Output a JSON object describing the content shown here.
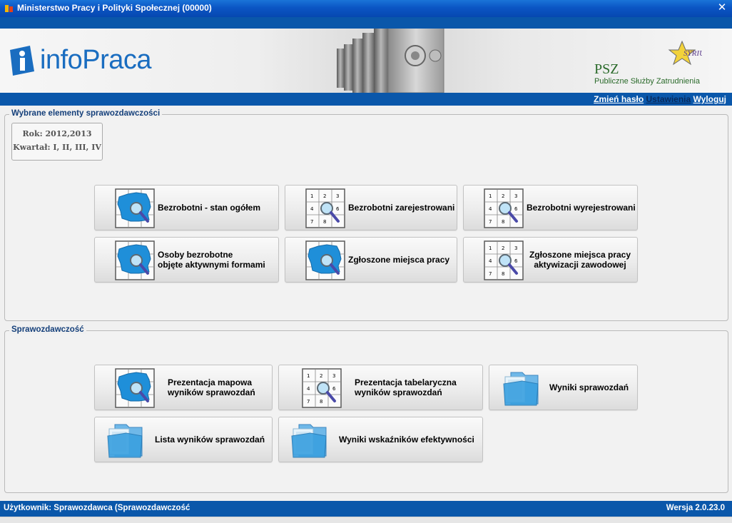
{
  "window": {
    "title": "Ministerstwo Pracy i Polityki Społecznej (00000)"
  },
  "header": {
    "logo_text": "infoPraca",
    "psz_title": "PSZ",
    "psz_subtitle": "Publiczne Służby Zatrudnienia",
    "links": {
      "change_password": "Zmień hasło",
      "settings": "Ustawienia",
      "logout": "Wyloguj"
    }
  },
  "selected": {
    "title": "Wybrane elementy sprawozdawczości",
    "year": "Rok: 2012,2013",
    "quarter": "Kwartał: I, II, III, IV",
    "buttons": [
      {
        "label": "Bezrobotni - stan ogółem",
        "icon": "map-icon"
      },
      {
        "label": "Bezrobotni zarejestrowani",
        "icon": "table-icon"
      },
      {
        "label": "Bezrobotni wyrejestrowani",
        "icon": "table-icon"
      },
      {
        "label1": "Osoby bezrobotne",
        "label2": "objęte aktywnymi formami",
        "icon": "map-icon"
      },
      {
        "label": "Zgłoszone miejsca pracy",
        "icon": "map-icon"
      },
      {
        "label1": "Zgłoszone miejsca pracy",
        "label2": "aktywizacji zawodowej",
        "icon": "table-icon"
      }
    ]
  },
  "reporting": {
    "title": "Sprawozdawczość",
    "buttons": [
      {
        "label1": "Prezentacja mapowa",
        "label2": "wyników sprawozdań",
        "icon": "map-icon"
      },
      {
        "label1": "Prezentacja tabelaryczna",
        "label2": "wyników sprawozdań",
        "icon": "table-icon"
      },
      {
        "label": "Wyniki sprawozdań",
        "icon": "folder-icon"
      },
      {
        "label": "Lista wyników sprawozdań",
        "icon": "folder-icon"
      },
      {
        "label": "Wyniki wskaźników efektywności",
        "icon": "folder-icon"
      }
    ]
  },
  "status": {
    "user": "Użytkownik: Sprawozdawca (Sprawozdawczość",
    "version": "Wersja 2.0.23.0"
  },
  "colors": {
    "primary_blue": "#0a57aa",
    "title_blue": "#143f7a",
    "logo_blue": "#1a6dc0",
    "psz_green": "#2a6a2a"
  }
}
